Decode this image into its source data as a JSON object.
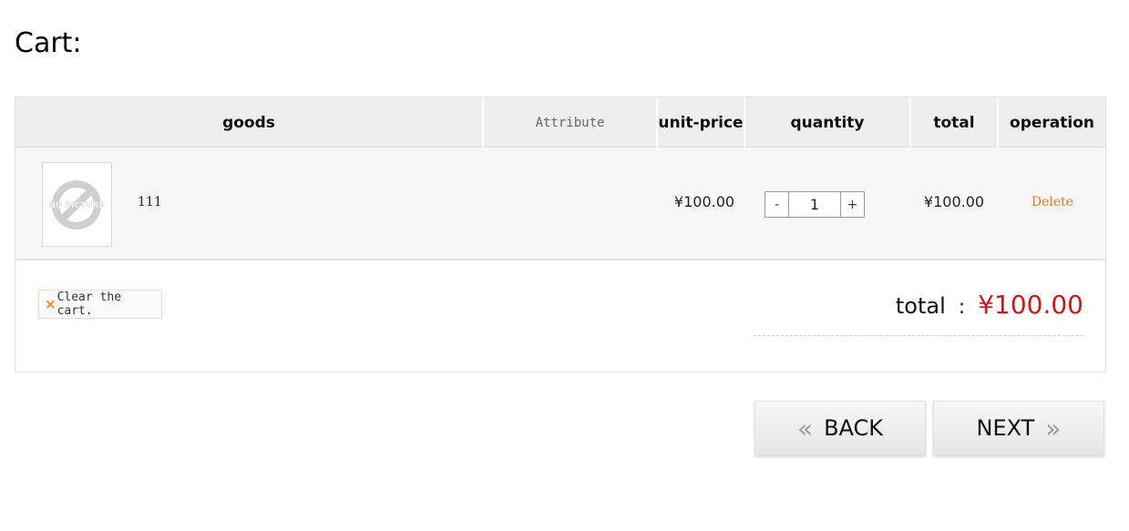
{
  "page_title": "Cart:",
  "table": {
    "headers": {
      "goods": "goods",
      "attribute": "Attribute",
      "unit_price": "unit-price",
      "quantity": "quantity",
      "total": "total",
      "operation": "operation"
    },
    "items": [
      {
        "thumbnail_text": "NO PICTURE",
        "name": "111",
        "attribute": "",
        "unit_price": "¥100.00",
        "quantity": "1",
        "line_total": "¥100.00",
        "delete_label": "Delete"
      }
    ],
    "stepper": {
      "minus": "-",
      "plus": "+"
    }
  },
  "footer": {
    "clear_icon": "×",
    "clear_label": "Clear the cart.",
    "total_label": "total",
    "total_colon": ":",
    "total_value": "¥100.00"
  },
  "navigation": {
    "back_label": "BACK",
    "back_icon": "«",
    "next_label": "NEXT",
    "next_icon": "»"
  },
  "colors": {
    "accent_red": "#c41a1a",
    "delete_orange": "#e07a1f",
    "header_bg": "#eeeeee"
  }
}
